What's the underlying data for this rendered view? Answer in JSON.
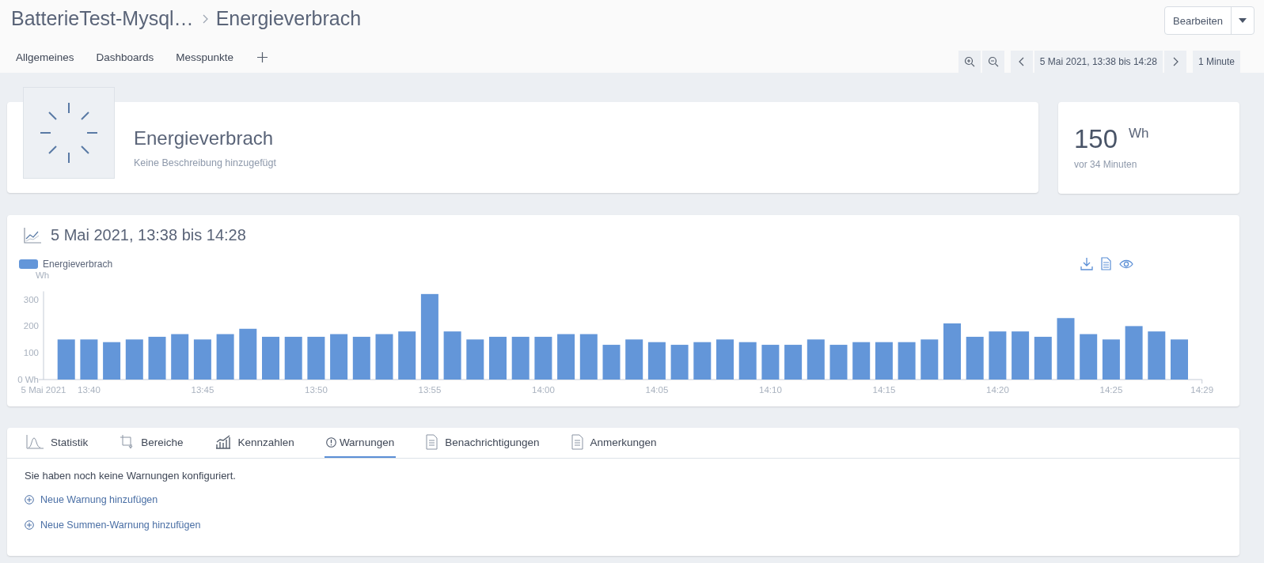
{
  "breadcrumb": {
    "parent": "BatterieTest-Mysql…",
    "current": "Energieverbrach"
  },
  "edit_button": {
    "label": "Bearbeiten"
  },
  "nav_tabs": [
    {
      "label": "Allgemeines"
    },
    {
      "label": "Dashboards"
    },
    {
      "label": "Messpunkte"
    }
  ],
  "time_range": {
    "label": "5 Mai 2021, 13:38 bis 14:28",
    "interval": "1 Minute"
  },
  "header_card": {
    "title": "Energieverbrach",
    "description": "Keine Beschreibung hinzugefügt"
  },
  "value_card": {
    "value": "150",
    "unit": "Wh",
    "age": "vor 34 Minuten"
  },
  "chart_panel": {
    "title": "5 Mai 2021, 13:38 bis 14:28",
    "chart_data": {
      "type": "bar",
      "ylabel": "Wh",
      "categories": [
        "5 Mai 2021",
        null,
        "13:40",
        null,
        null,
        null,
        null,
        "13:45",
        null,
        null,
        null,
        null,
        "13:50",
        null,
        null,
        null,
        null,
        "13:55",
        null,
        null,
        null,
        null,
        "14:00",
        null,
        null,
        null,
        null,
        "14:05",
        null,
        null,
        null,
        null,
        "14:10",
        null,
        null,
        null,
        null,
        "14:15",
        null,
        null,
        null,
        null,
        "14:20",
        null,
        null,
        null,
        null,
        "14:25",
        null,
        null,
        null,
        "14:29"
      ],
      "series": [
        {
          "name": "Energieverbrach",
          "color": "#6396d9",
          "values": [
            null,
            150,
            150,
            140,
            150,
            160,
            170,
            150,
            170,
            190,
            160,
            160,
            160,
            170,
            160,
            170,
            180,
            320,
            180,
            150,
            160,
            160,
            160,
            170,
            170,
            130,
            150,
            140,
            130,
            140,
            150,
            140,
            130,
            130,
            150,
            130,
            140,
            140,
            140,
            150,
            210,
            160,
            180,
            180,
            160,
            230,
            170,
            150,
            200,
            180,
            150,
            null
          ]
        }
      ],
      "ylim": [
        0,
        330
      ],
      "yticks": [
        {
          "value": 0,
          "label": "0 Wh"
        },
        100,
        200,
        300
      ]
    }
  },
  "detail_tabs": [
    {
      "label": "Statistik",
      "kind": "distribution",
      "selected": false
    },
    {
      "label": "Bereiche",
      "kind": "range",
      "selected": false
    },
    {
      "label": "Kennzahlen",
      "kind": "metrics",
      "selected": false
    },
    {
      "label": "Warnungen",
      "kind": "warning",
      "selected": true
    },
    {
      "label": "Benachrichtigungen",
      "kind": "document",
      "selected": false
    },
    {
      "label": "Anmerkungen",
      "kind": "document",
      "selected": false
    }
  ],
  "warnings": {
    "message": "Sie haben noch keine Warnungen konfiguriert.",
    "links": [
      "Neue Warnung hinzufügen",
      "Neue Summen-Warnung hinzufügen"
    ]
  }
}
